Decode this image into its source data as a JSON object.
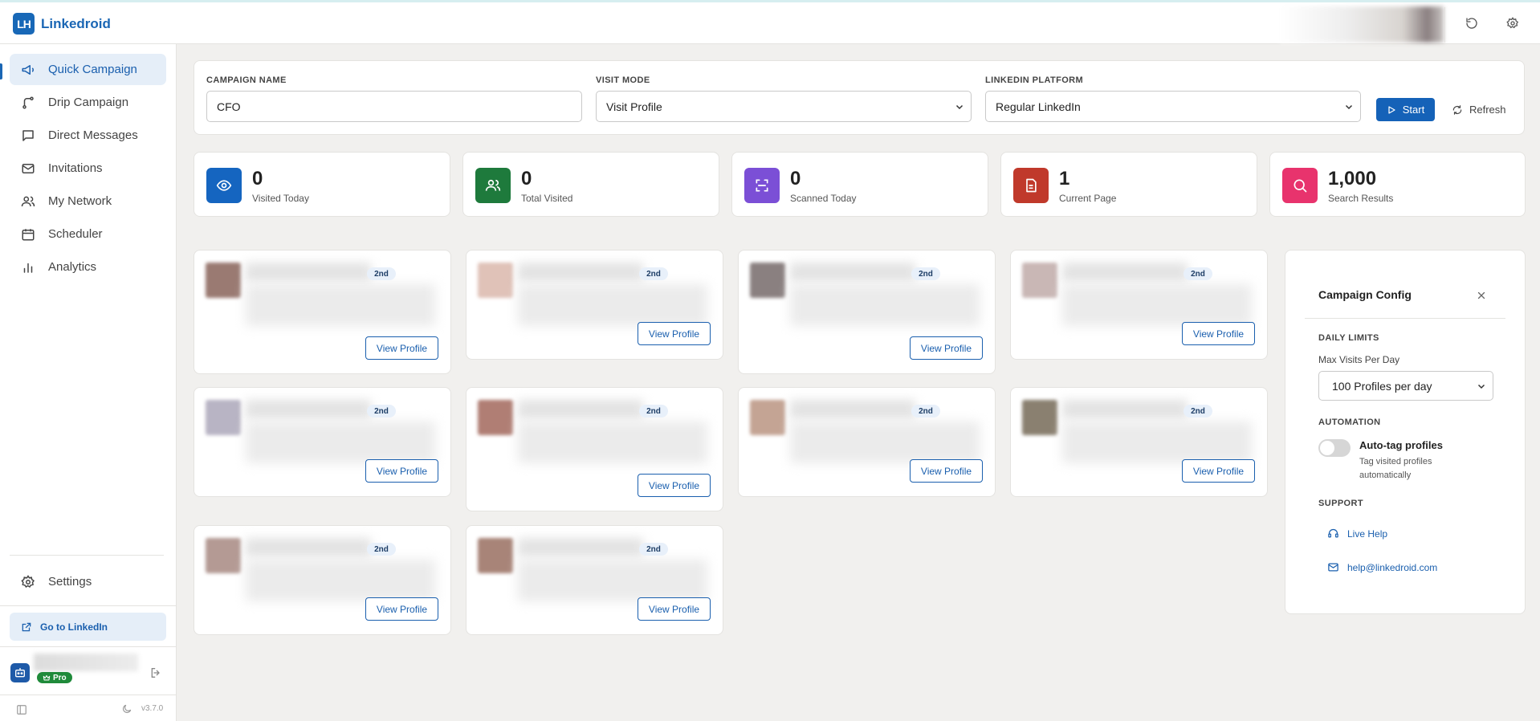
{
  "app": {
    "logo_mark": "LH",
    "title": "Linkedroid"
  },
  "header": {
    "icons": [
      "refresh-icon",
      "gear-icon"
    ]
  },
  "sidebar": {
    "items": [
      {
        "label": "Quick Campaign",
        "icon": "megaphone-icon",
        "active": true
      },
      {
        "label": "Drip Campaign",
        "icon": "route-icon"
      },
      {
        "label": "Direct Messages",
        "icon": "message-icon"
      },
      {
        "label": "Invitations",
        "icon": "mail-icon"
      },
      {
        "label": "My Network",
        "icon": "users-icon"
      },
      {
        "label": "Scheduler",
        "icon": "calendar-icon"
      },
      {
        "label": "Analytics",
        "icon": "bar-chart-icon"
      }
    ],
    "settings_label": "Settings",
    "goto_label": "Go to LinkedIn",
    "pro_label": "Pro",
    "version": "v3.7.0"
  },
  "campaign": {
    "name_label": "CAMPAIGN NAME",
    "name_value": "CFO",
    "mode_label": "VISIT MODE",
    "mode_value": "Visit Profile",
    "platform_label": "LINKEDIN PLATFORM",
    "platform_value": "Regular LinkedIn",
    "start_label": "Start",
    "refresh_label": "Refresh"
  },
  "stats": [
    {
      "value": "0",
      "label": "Visited Today",
      "icon": "eye-icon",
      "color": "#1565c0"
    },
    {
      "value": "0",
      "label": "Total Visited",
      "icon": "users-icon",
      "color": "#1e7a3c"
    },
    {
      "value": "0",
      "label": "Scanned Today",
      "icon": "scan-icon",
      "color": "#7b4fd6"
    },
    {
      "value": "1",
      "label": "Current Page",
      "icon": "document-icon",
      "color": "#c0392b"
    },
    {
      "value": "1,000",
      "label": "Search Results",
      "icon": "search-icon",
      "color": "#e8336d"
    }
  ],
  "profiles": [
    {
      "degree": "2nd",
      "button": "View Profile"
    },
    {
      "degree": "2nd",
      "button": "View Profile"
    },
    {
      "degree": "2nd",
      "button": "View Profile"
    },
    {
      "degree": "2nd",
      "button": "View Profile"
    },
    {
      "degree": "2nd",
      "button": "View Profile"
    },
    {
      "degree": "2nd",
      "button": "View Profile"
    },
    {
      "degree": "2nd",
      "button": "View Profile"
    },
    {
      "degree": "2nd",
      "button": "View Profile"
    },
    {
      "degree": "2nd",
      "button": "View Profile"
    },
    {
      "degree": "2nd",
      "button": "View Profile"
    }
  ],
  "config": {
    "title": "Campaign Config",
    "daily_limits_label": "DAILY LIMITS",
    "max_visits_label": "Max Visits Per Day",
    "max_visits_value": "100 Profiles per day",
    "automation_label": "AUTOMATION",
    "auto_tag_title": "Auto-tag profiles",
    "auto_tag_desc": "Tag visited profiles automatically",
    "auto_tag_enabled": false,
    "support_label": "SUPPORT",
    "live_help_label": "Live Help",
    "email_label": "help@linkedroid.com"
  }
}
